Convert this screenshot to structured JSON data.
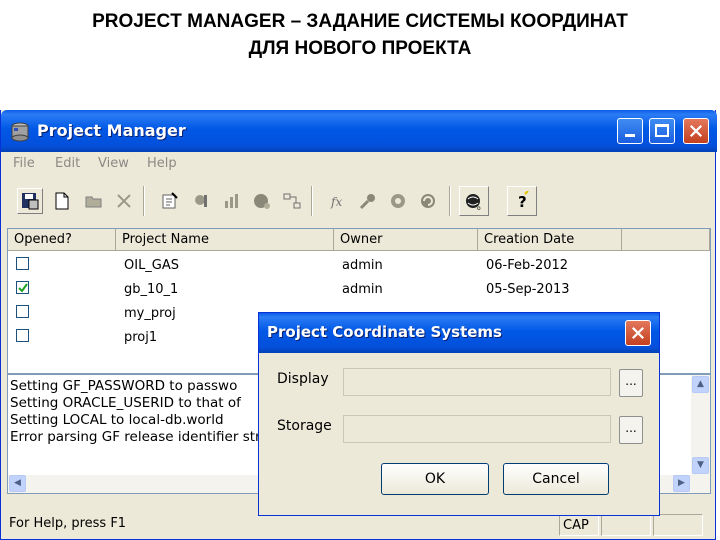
{
  "slide": {
    "title_line1": "PROJECT MANAGER – ЗАДАНИЕ СИСТЕМЫ КООРДИНАТ",
    "title_line2": "ДЛЯ НОВОГО ПРОЕКТА"
  },
  "window": {
    "title": "Project Manager",
    "controls": {
      "minimize": "_",
      "maximize": "□",
      "close": "✕"
    },
    "icon": "database-icon"
  },
  "menu": [
    "File",
    "Edit",
    "View",
    "Help"
  ],
  "toolbar_icons": [
    "save-disk-icon",
    "new-document-icon",
    "open-folder-icon",
    "delete-x-icon",
    "edit-properties-icon",
    "tools-icon",
    "chart-icon",
    "sphere-icon",
    "network-icon",
    "function-icon",
    "key-icon",
    "settings-icon",
    "refresh-icon",
    "globe-help-icon",
    "help-icon"
  ],
  "table": {
    "columns": [
      "Opened?",
      "Project Name",
      "Owner",
      "Creation Date"
    ],
    "rows": [
      {
        "opened": false,
        "name": "OIL_GAS",
        "owner": "admin",
        "date": "06-Feb-2012"
      },
      {
        "opened": true,
        "name": "gb_10_1",
        "owner": "admin",
        "date": "05-Sep-2013"
      },
      {
        "opened": false,
        "name": "my_proj",
        "owner": "",
        "date": ""
      },
      {
        "opened": false,
        "name": "proj1",
        "owner": "",
        "date": ""
      }
    ]
  },
  "log": [
    "Setting GF_PASSWORD to passwo",
    "Setting ORACLE_USERID to that of",
    "Setting LOCAL to local-db.world",
    "Error parsing GF release identifier stri"
  ],
  "status": {
    "help_text": "For Help, press F1",
    "caps": "CAP"
  },
  "dialog": {
    "title": "Project Coordinate Systems",
    "display_label": "Display",
    "storage_label": "Storage",
    "display_value": "",
    "storage_value": "",
    "browse_label": "...",
    "ok_label": "OK",
    "cancel_label": "Cancel"
  }
}
